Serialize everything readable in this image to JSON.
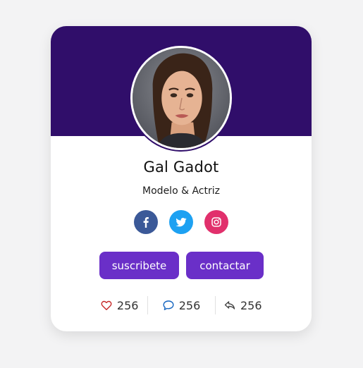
{
  "profile": {
    "name": "Gal Gadot",
    "role": "Modelo & Actriz",
    "avatar_alt": "Gal Gadot"
  },
  "social": [
    {
      "icon": "facebook-icon",
      "color": "#3b5998"
    },
    {
      "icon": "twitter-icon",
      "color": "#1da1f2"
    },
    {
      "icon": "instagram-icon",
      "color": "#e1306c"
    }
  ],
  "actions": {
    "subscribe_label": "suscribete",
    "contact_label": "contactar"
  },
  "stats": {
    "likes": "256",
    "comments": "256",
    "shares": "256"
  },
  "colors": {
    "header": "#300e6a",
    "button": "#6a2fc8",
    "background": "#f3f3f4",
    "like_icon": "#c62828",
    "comment_icon": "#1565c0"
  }
}
